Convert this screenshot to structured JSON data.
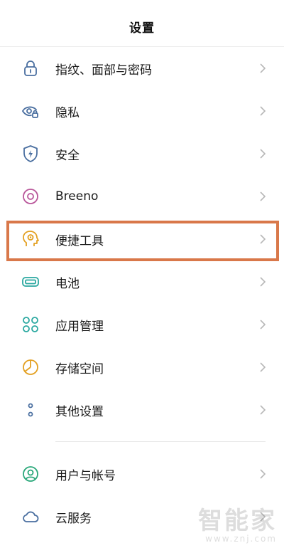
{
  "header": {
    "title": "设置"
  },
  "items": [
    {
      "label": "指纹、面部与密码",
      "icon": "lock-icon",
      "color": "#4a6fa0"
    },
    {
      "label": "隐私",
      "icon": "privacy-eye-icon",
      "color": "#4a6fa0"
    },
    {
      "label": "安全",
      "icon": "shield-icon",
      "color": "#4a6fa0"
    },
    {
      "label": "Breeno",
      "icon": "breeno-icon",
      "color": "#b9569a"
    },
    {
      "label": "便捷工具",
      "icon": "assistant-head-icon",
      "color": "#e3a021"
    },
    {
      "label": "电池",
      "icon": "battery-icon",
      "color": "#2aa8a0"
    },
    {
      "label": "应用管理",
      "icon": "apps-grid-icon",
      "color": "#2aa8a0"
    },
    {
      "label": "存储空间",
      "icon": "storage-pie-icon",
      "color": "#e3a021"
    },
    {
      "label": "其他设置",
      "icon": "more-dots-icon",
      "color": "#4a6fa0"
    },
    {
      "label": "用户与帐号",
      "icon": "user-account-icon",
      "color": "#2aa87a"
    },
    {
      "label": "云服务",
      "icon": "cloud-icon",
      "color": "#4a6fa0"
    }
  ],
  "highlight_color": "#d9784a",
  "watermark": {
    "title": "智能家",
    "url": "www.znj.com"
  }
}
